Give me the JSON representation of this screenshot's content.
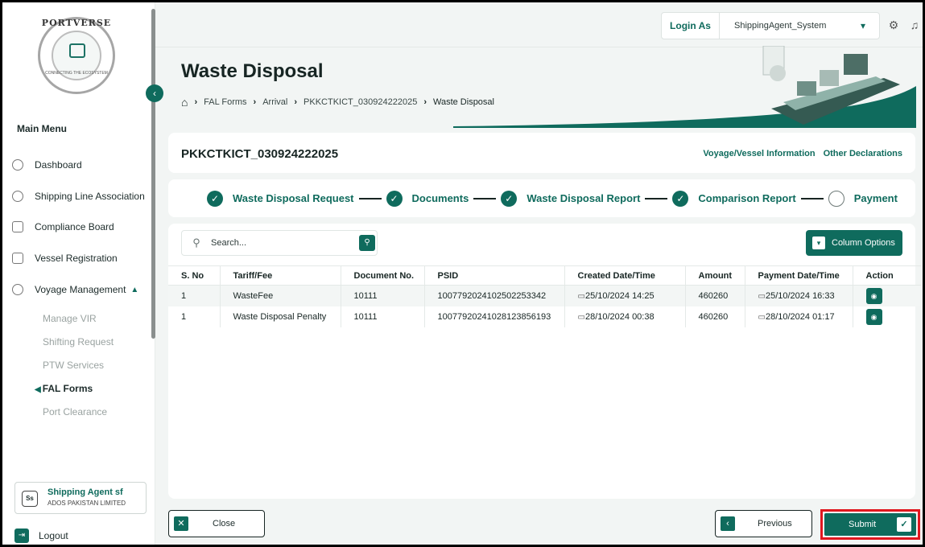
{
  "brand": {
    "name": "PORTVERSE",
    "tagline": "CONNECTING THE ECOSYSTEM"
  },
  "sidebar": {
    "main_menu": "Main Menu",
    "items": [
      {
        "label": "Dashboard",
        "icon": "dashboard-icon"
      },
      {
        "label": "Shipping Line Association",
        "icon": "association-icon"
      },
      {
        "label": "Compliance Board",
        "icon": "compliance-icon"
      },
      {
        "label": "Vessel Registration",
        "icon": "vessel-icon"
      },
      {
        "label": "Voyage Management",
        "icon": "voyage-icon"
      }
    ],
    "sub_items": [
      {
        "label": "Manage VIR"
      },
      {
        "label": "Shifting Request"
      },
      {
        "label": "PTW Services"
      },
      {
        "label": "FAL Forms",
        "active": true
      },
      {
        "label": "Port Clearance"
      }
    ],
    "profile": {
      "initials": "Ss",
      "name": "Shipping Agent sf",
      "company": "ADOS PAKISTAN LIMITED"
    },
    "logout": "Logout"
  },
  "topbar": {
    "login_as_label": "Login As",
    "login_as_value": "ShippingAgent_System"
  },
  "header": {
    "title": "Waste Disposal",
    "breadcrumb": [
      "FAL Forms",
      "Arrival",
      "PKKCTKICT_030924222025",
      "Waste Disposal"
    ]
  },
  "voyage_card": {
    "title": "PKKCTKICT_030924222025",
    "link_1": "Voyage/Vessel Information",
    "link_2": "Other Declarations"
  },
  "steps": [
    {
      "label": "Waste Disposal Request",
      "done": true
    },
    {
      "label": "Documents",
      "done": true
    },
    {
      "label": "Waste Disposal Report",
      "done": true
    },
    {
      "label": "Comparison Report",
      "done": true
    },
    {
      "label": "Payment",
      "done": false
    }
  ],
  "table_tools": {
    "search_placeholder": "Search...",
    "column_options": "Column Options"
  },
  "table": {
    "headers": [
      "S. No",
      "Tariff/Fee",
      "Document No.",
      "PSID",
      "Created Date/Time",
      "Amount",
      "Payment Date/Time",
      "Action"
    ],
    "rows": [
      [
        "1",
        "WasteFee",
        "10111",
        "1007792024102502253342",
        "25/10/2024 14:25",
        "460260",
        "25/10/2024 16:33"
      ],
      [
        "1",
        "Waste Disposal Penalty",
        "10111",
        "1007792024102812385619​3",
        "28/10/2024 00:38",
        "460260",
        "28/10/2024 01:17"
      ]
    ]
  },
  "footer": {
    "close": "Close",
    "previous": "Previous",
    "submit": "Submit"
  },
  "colors": {
    "primary": "#0f6b5d",
    "highlight": "#e0171f",
    "background": "#f2f5f4"
  }
}
